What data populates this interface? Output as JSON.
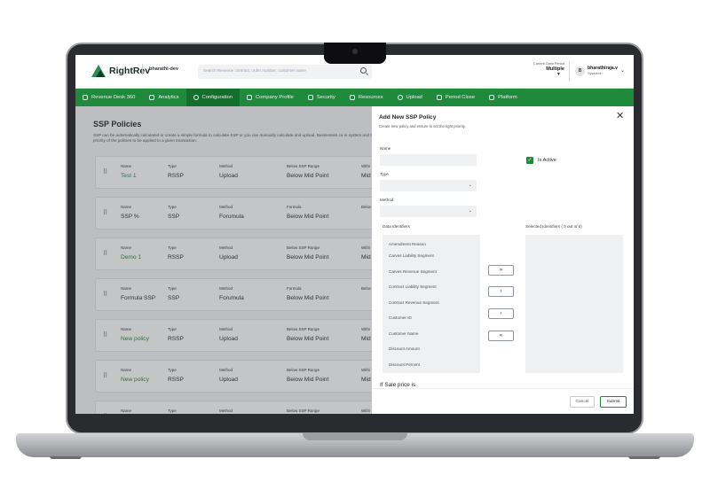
{
  "app": {
    "brand": "RightRev",
    "environment": "bharathi-dev",
    "search_placeholder": "Search Revenue contract, order number, customer name",
    "period_label": "Current Open Period",
    "period_value": "Multiple",
    "user_initial": "B",
    "user_name": "bharathiraja.v",
    "user_role": "Sysadmin"
  },
  "nav": [
    {
      "label": "Revenue Desk 360",
      "icon": "gauge-icon",
      "active": false
    },
    {
      "label": "Analytics",
      "icon": "bar-chart-icon",
      "active": false
    },
    {
      "label": "Configuration",
      "icon": "gear-icon",
      "active": true
    },
    {
      "label": "Company Profile",
      "icon": "document-icon",
      "active": false
    },
    {
      "label": "Security",
      "icon": "lock-icon",
      "active": false
    },
    {
      "label": "Resources",
      "icon": "book-icon",
      "active": false
    },
    {
      "label": "Upload",
      "icon": "cloud-upload-icon",
      "active": false
    },
    {
      "label": "Period Close",
      "icon": "calendar-icon",
      "active": false
    },
    {
      "label": "Platform",
      "icon": "layers-icon",
      "active": false
    }
  ],
  "page": {
    "title": "SSP Policies",
    "description": "SSP can be automatically calculated or create a simple formula to calculate SSP or you can manually calculate and upload. Businesses ca in system and the priority of the policies to be applied to a given transaction."
  },
  "policies": [
    {
      "name_label": "Name",
      "name": "Test 1",
      "name_is_link": true,
      "type_label": "Type",
      "type": "RSSP",
      "method_label": "Method",
      "method": "Upload",
      "range_label": "Below SSP Range",
      "range": "Below Mid Point",
      "extra_label": "Withi",
      "extra": "Mid"
    },
    {
      "name_label": "Name",
      "name": "SSP %",
      "name_is_link": false,
      "type_label": "Type",
      "type": "SSP",
      "method_label": "Method",
      "method": "Forumula",
      "range_label": "Formula",
      "range": "Below Mid Point",
      "extra_label": "Belov",
      "extra": ""
    },
    {
      "name_label": "Name",
      "name": "Demo 1",
      "name_is_link": true,
      "type_label": "Type",
      "type": "RSSP",
      "method_label": "Method",
      "method": "Upload",
      "range_label": "Below SSP Range",
      "range": "Below Mid Point",
      "extra_label": "Withi",
      "extra": "Mid"
    },
    {
      "name_label": "Name",
      "name": "Formula SSP",
      "name_is_link": false,
      "type_label": "Type",
      "type": "SSP",
      "method_label": "Method",
      "method": "Forumula",
      "range_label": "Formula",
      "range": "Below Mid Point",
      "extra_label": "Belov",
      "extra": ""
    },
    {
      "name_label": "Name",
      "name": "New policy",
      "name_is_link": true,
      "type_label": "Type",
      "type": "RSSP",
      "method_label": "Method",
      "method": "Upload",
      "range_label": "Below SSP Range",
      "range": "Below Mid Point",
      "extra_label": "Withi",
      "extra": "Mid"
    },
    {
      "name_label": "Name",
      "name": "New policy",
      "name_is_link": true,
      "type_label": "Type",
      "type": "RSSP",
      "method_label": "Method",
      "method": "Upload",
      "range_label": "Below SSP Range",
      "range": "Below Mid Point",
      "extra_label": "Withi",
      "extra": "Mid"
    },
    {
      "name_label": "Name",
      "name": "",
      "name_is_link": false,
      "type_label": "Type",
      "type": "",
      "method_label": "Method",
      "method": "",
      "range_label": "Below SSP Range",
      "range": "",
      "extra_label": "Withi",
      "extra": ""
    }
  ],
  "drawer": {
    "title": "Add New SSP Policy",
    "subtitle": "Create new policy and ensure to set the right priority.",
    "name_label": "Name",
    "type_label": "Type",
    "method_label": "Method",
    "is_active_label": "Is Active",
    "is_active_checked": true,
    "data_identifiers_label": "Data Identifiers",
    "selected_identifiers_label": "Selected Identifiers ( 0 out of 5)",
    "identifiers": [
      "Amendment Reason",
      "Carves Liability Segment",
      "Carves Revenue Segment",
      "Contract Liability Segment",
      "Contract Revenue Segment",
      "Customer ID",
      "Customer Name",
      "Discount Amount",
      "Discount Percent"
    ],
    "move_buttons": [
      "»",
      "›",
      "‹",
      "«"
    ],
    "if_sale_label": "If Sale price is",
    "cancel_label": "Cancel",
    "submit_label": "Submit"
  }
}
